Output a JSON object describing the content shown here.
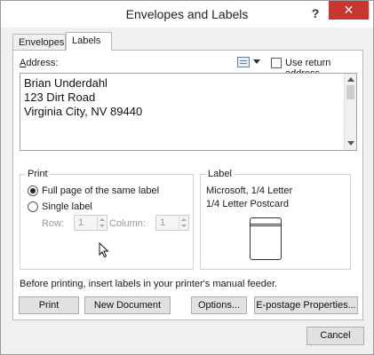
{
  "window": {
    "title": "Envelopes and Labels",
    "help_glyph": "?",
    "close_glyph": "✕"
  },
  "tabs": [
    {
      "label": "Envelopes",
      "active": false
    },
    {
      "label": "Labels",
      "active": true
    }
  ],
  "address": {
    "label": "Address:",
    "lines": [
      "Brian Underdahl",
      "123 Dirt Road",
      "Virginia City, NV 89440"
    ],
    "use_return_address_label": "Use return address",
    "use_return_address_checked": false
  },
  "print": {
    "group_title": "Print",
    "full_page_label": "Full page of the same label",
    "single_label": "Single label",
    "selected": "full_page",
    "row_label": "Row:",
    "row_value": "1",
    "column_label": "Column:",
    "column_value": "1"
  },
  "label": {
    "group_title": "Label",
    "vendor": "Microsoft, 1/4 Letter",
    "product": "1/4 Letter Postcard"
  },
  "notice": "Before printing, insert labels in your printer's manual feeder.",
  "buttons": {
    "print": "Print",
    "new_document": "New Document",
    "options": "Options...",
    "epostage": "E-postage Properties...",
    "cancel": "Cancel"
  },
  "colors": {
    "close_button": "#c7372f",
    "dialog_background": "#f0f0f0"
  }
}
